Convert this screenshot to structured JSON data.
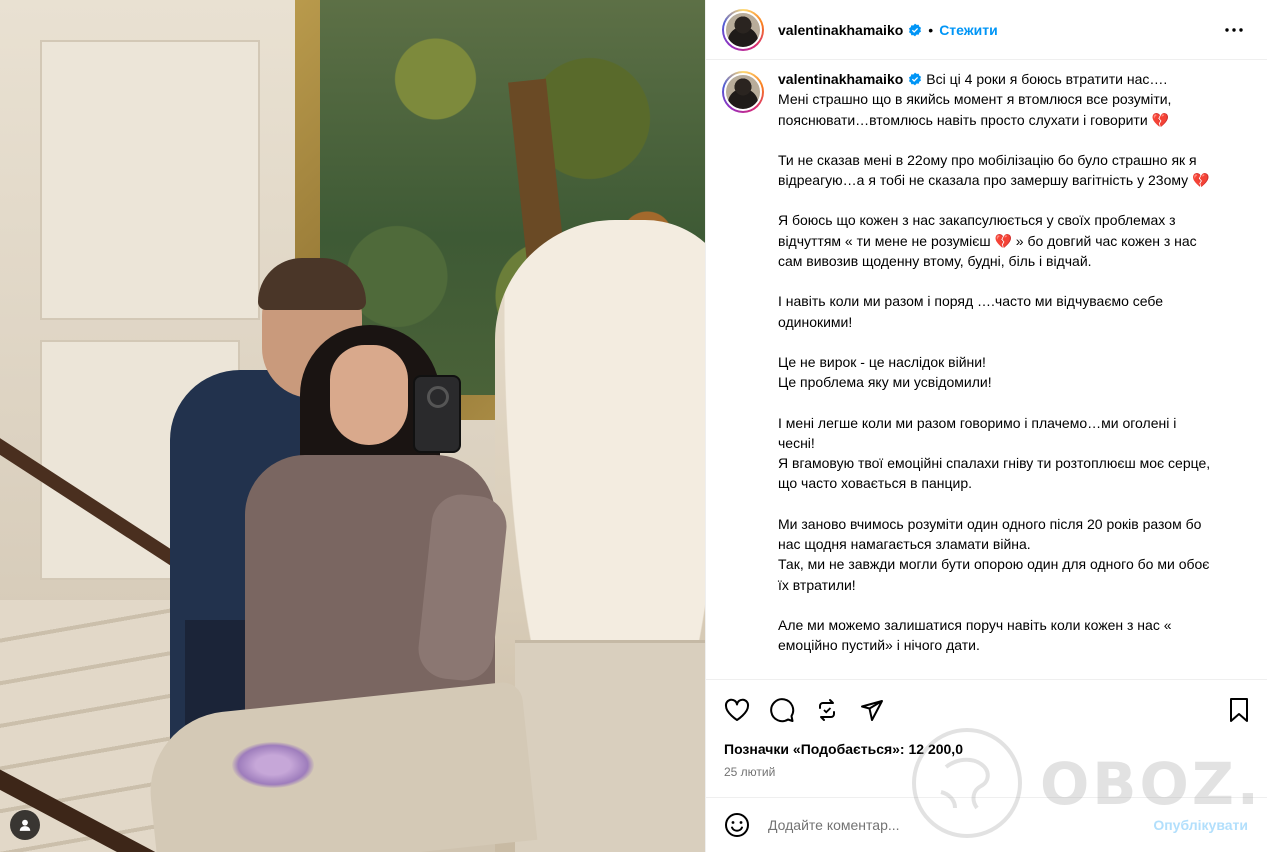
{
  "post": {
    "username": "valentinakhamaiko",
    "follow_label": "Стежити",
    "separator": "•",
    "caption_paragraphs": [
      "Всі ці 4 роки я боюсь втратити нас….\nМені страшно що в якийсь момент я втомлюся все розуміти, пояснювати…втомлюсь навіть просто слухати і говорити 💔",
      "Ти не сказав мені в 22ому про мобілізацію бо було страшно як я відреагую…а я тобі не сказала про замершу вагітність у 23ому 💔",
      "Я боюсь що кожен з нас закапсулюється у своїх проблемах з відчуттям « ти мене не розумієш 💔 » бо довгий час кожен з нас сам вивозив щоденну втому, будні, біль і відчай.",
      "І навіть коли ми разом і поряд ….часто ми відчуваємо себе одинокими!",
      "Це не вирок - це наслідок війни!\nЦе проблема яку ми усвідомили!",
      "І мені легше коли ми разом говоримо і плачемо…ми оголені і чесні!\nЯ вгамовую твої емоційні спалахи гніву ти розтоплюєш моє серце, що часто ховається в панцир.",
      "Ми заново вчимось розуміти один одного після 20 років разом бо нас щодня намагається зламати війна.\nТак, ми не завжди могли бути опорою один для одного бо ми обоє їх втратили!",
      "Але ми можемо залишатися поруч навіть коли кожен з нас « емоційно пустий» і нічого дати."
    ],
    "likes_text": "Позначки «Подобається»: 12 200,0",
    "date": "25 лютий",
    "comment_placeholder": "Додайте коментар...",
    "publish_label": "Опублікувати"
  },
  "watermark": {
    "text": "OBOZ.UA"
  },
  "icons": {
    "verified": "verified-badge-icon",
    "more": "more-options-icon",
    "like": "heart-icon",
    "comment": "comment-icon",
    "share": "share-icon",
    "send": "send-icon",
    "save": "bookmark-icon",
    "emoji": "emoji-icon",
    "user_tag": "user-tag-icon"
  },
  "colors": {
    "accent": "#0095f6",
    "publish_disabled": "#b2dffc",
    "muted_text": "#737373",
    "divider": "#efefef"
  }
}
